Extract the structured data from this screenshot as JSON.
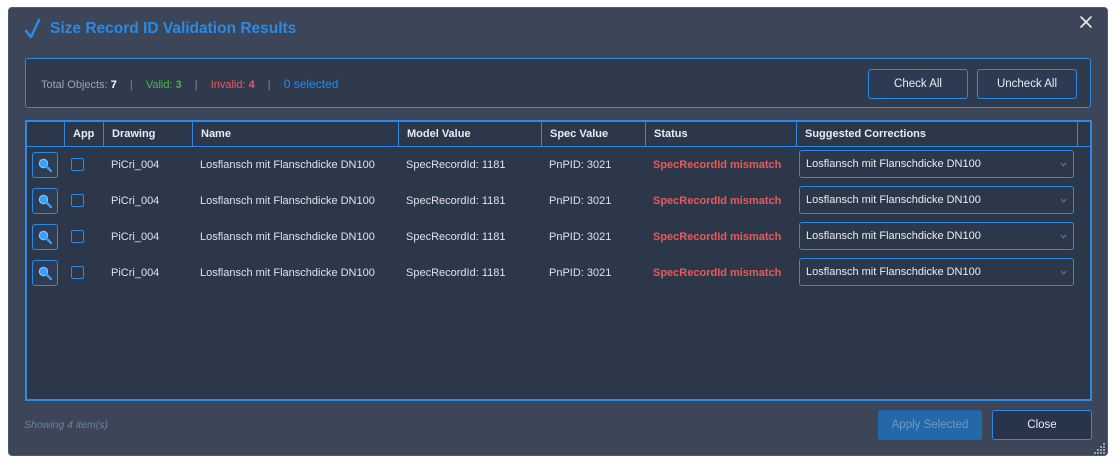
{
  "dialog": {
    "title": "Size Record ID Validation Results",
    "icons": {
      "title": "check-icon",
      "close": "close-icon",
      "resize": "resize-grip-icon"
    }
  },
  "summary": {
    "total_label": "Total Objects:",
    "total_value": "7",
    "sep": "|",
    "valid_label": "Valid:",
    "valid_value": "3",
    "invalid_label": "Invalid:",
    "invalid_value": "4",
    "selected_text": "0 selected",
    "check_all": "Check All",
    "uncheck_all": "Uncheck All"
  },
  "table": {
    "columns": [
      "App",
      "Drawing",
      "Name",
      "Model Value",
      "Spec Value",
      "Status",
      "Suggested Corrections"
    ],
    "rows": [
      {
        "checked": false,
        "drawing": "PiCri_004",
        "name": "Losflansch mit Flanschdicke DN100",
        "model_value": "SpecRecordId: 1181",
        "spec_value": "PnPID: 3021",
        "status": "SpecRecordId mismatch",
        "correction": "Losflansch mit Flanschdicke DN100"
      },
      {
        "checked": false,
        "drawing": "PiCri_004",
        "name": "Losflansch mit Flanschdicke DN100",
        "model_value": "SpecRecordId: 1181",
        "spec_value": "PnPID: 3021",
        "status": "SpecRecordId mismatch",
        "correction": "Losflansch mit Flanschdicke DN100"
      },
      {
        "checked": false,
        "drawing": "PiCri_004",
        "name": "Losflansch mit Flanschdicke DN100",
        "model_value": "SpecRecordId: 1181",
        "spec_value": "PnPID: 3021",
        "status": "SpecRecordId mismatch",
        "correction": "Losflansch mit Flanschdicke DN100"
      },
      {
        "checked": false,
        "drawing": "PiCri_004",
        "name": "Losflansch mit Flanschdicke DN100",
        "model_value": "SpecRecordId: 1181",
        "spec_value": "PnPID: 3021",
        "status": "SpecRecordId mismatch",
        "correction": "Losflansch mit Flanschdicke DN100"
      }
    ],
    "row_icon": "zoom-icon"
  },
  "footer": {
    "showing_text": "Showing 4 item(s)",
    "apply_selected": "Apply Selected",
    "close": "Close"
  },
  "colors": {
    "accent": "#2a8ae6",
    "background": "#3c4658",
    "valid": "#4cb24c",
    "invalid": "#e85a5a"
  }
}
